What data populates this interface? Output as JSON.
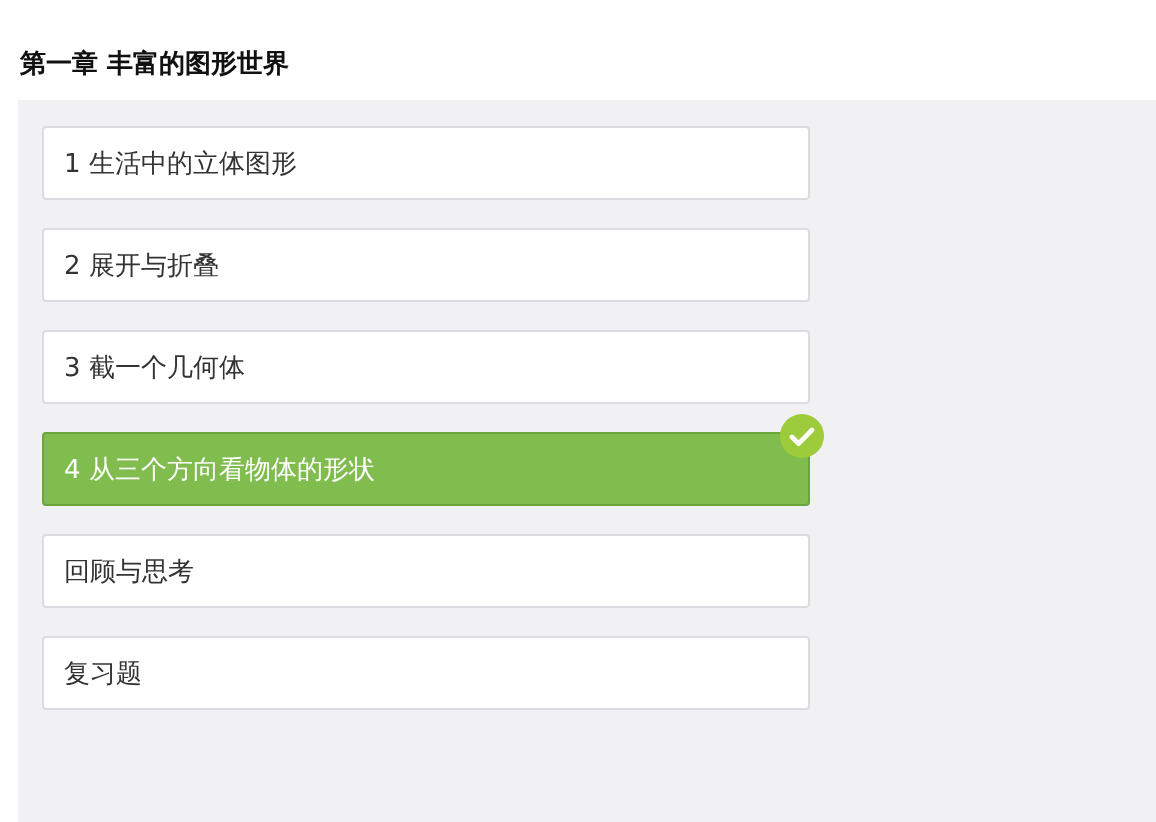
{
  "chapter_title": "第一章 丰富的图形世界",
  "lessons": [
    {
      "label": "1 生活中的立体图形",
      "selected": false
    },
    {
      "label": "2 展开与折叠",
      "selected": false
    },
    {
      "label": "3 截一个几何体",
      "selected": false
    },
    {
      "label": "4 从三个方向看物体的形状",
      "selected": true
    },
    {
      "label": "回顾与思考",
      "selected": false
    },
    {
      "label": "复习题",
      "selected": false
    }
  ]
}
